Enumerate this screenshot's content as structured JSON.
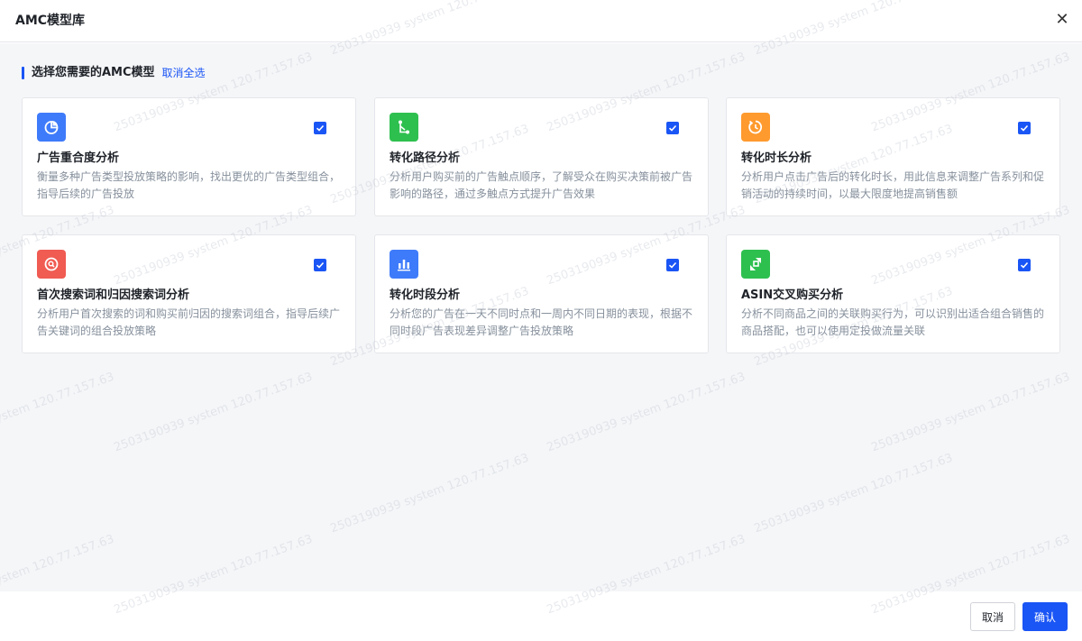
{
  "dialog": {
    "title": "AMC模型库",
    "close_glyph": "✕"
  },
  "section": {
    "label": "选择您需要的AMC模型",
    "deselect_all": "取消全选"
  },
  "models": [
    {
      "name": "广告重合度分析",
      "desc": "衡量多种广告类型投放策略的影响，找出更优的广告类型组合，指导后续的广告投放",
      "icon": "pie-chart-icon",
      "color": "#3e7bfa",
      "checked": true
    },
    {
      "name": "转化路径分析",
      "desc": "分析用户购买前的广告触点顺序，了解受众在购买决策前被广告影响的路径，通过多触点方式提升广告效果",
      "icon": "path-icon",
      "color": "#2ec04f",
      "checked": true
    },
    {
      "name": "转化时长分析",
      "desc": "分析用户点击广告后的转化时长，用此信息来调整广告系列和促销活动的持续时间，以最大限度地提高销售额",
      "icon": "timer-icon",
      "color": "#ff9a2e",
      "checked": true
    },
    {
      "name": "首次搜索词和归因搜索词分析",
      "desc": "分析用户首次搜索的词和购买前归因的搜索词组合，指导后续广告关键词的组合投放策略",
      "icon": "search-icon",
      "color": "#f05b52",
      "checked": true
    },
    {
      "name": "转化时段分析",
      "desc": "分析您的广告在一天不同时点和一周内不同日期的表现，根据不同时段广告表现差异调整广告投放策略",
      "icon": "bar-chart-icon",
      "color": "#3e7bfa",
      "checked": true
    },
    {
      "name": "ASIN交叉购买分析",
      "desc": "分析不同商品之间的关联购买行为，可以识别出适合组合销售的商品搭配，也可以使用定投做流量关联",
      "icon": "cross-arrows-icon",
      "color": "#2ec04f",
      "checked": true
    }
  ],
  "footer": {
    "cancel_label": "取消",
    "confirm_label": "确认"
  },
  "watermark": "2503190939 system 120.77.157.63",
  "colors": {
    "accent": "#1a55f5",
    "background": "#f5f6f8"
  }
}
